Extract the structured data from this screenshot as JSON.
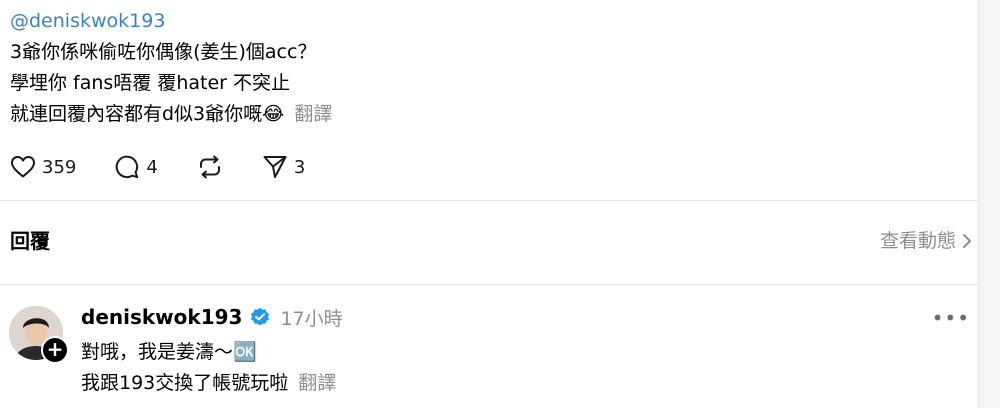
{
  "post": {
    "mention": "@deniskwok193",
    "line1": "3爺你係咪偷咗你偶像(姜生)個acc？",
    "line2": "學埋你 fans唔覆 覆hater 不突止",
    "line3": "就連回覆內容都有d似3爺你嘅😂",
    "translate": "翻譯"
  },
  "actions": {
    "likes": "359",
    "comments": "4",
    "shares": "3"
  },
  "replies_section": {
    "title": "回覆",
    "view_activity": "查看動態"
  },
  "reply": {
    "username": "deniskwok193",
    "time": "17小時",
    "line1": "對哦，我是姜濤～🆗",
    "line2": "我跟193交換了帳號玩啦",
    "translate": "翻譯",
    "more": "•••"
  },
  "colors": {
    "link_blue": "#3b82c4",
    "secondary_gray": "#8e8e8e",
    "verified_blue": "#1d9bf0"
  },
  "icons": [
    "heart-icon",
    "comment-icon",
    "repost-icon",
    "share-icon",
    "chevron-right-icon",
    "verified-badge-icon",
    "plus-icon",
    "more-icon"
  ]
}
